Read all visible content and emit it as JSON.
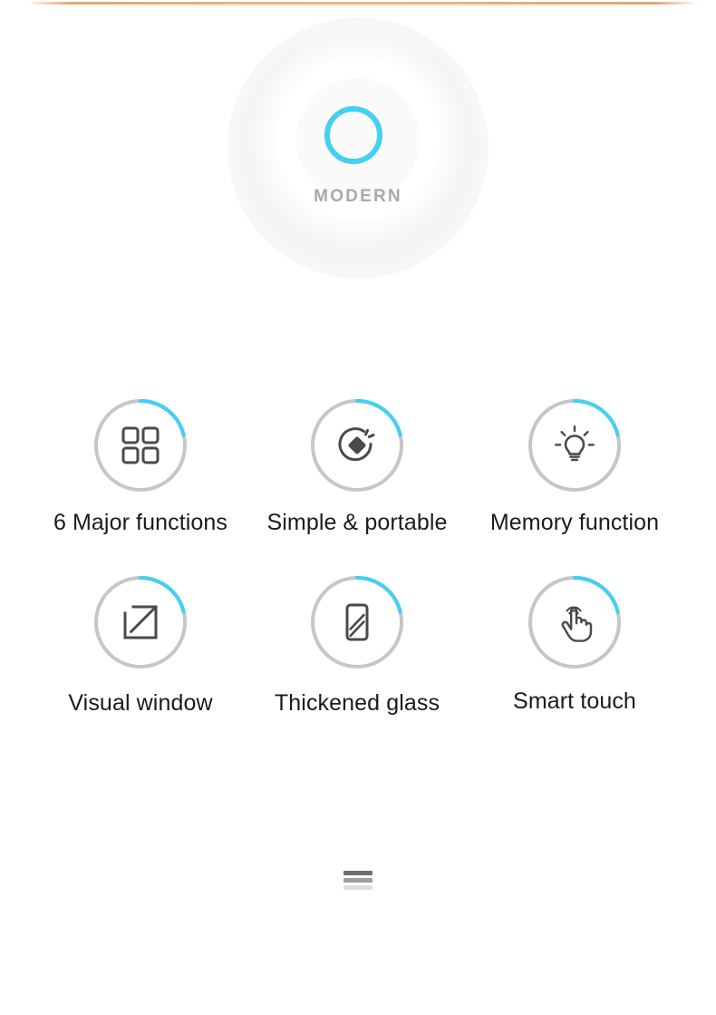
{
  "page": {
    "background_color": "#ffffff",
    "accent_color": "#45cff0",
    "ring_color": "#c6c6c6",
    "glyph_color": "#4a4a4a",
    "label_color": "#1b1b1b",
    "top_rule_color": "#e9b07c"
  },
  "hero": {
    "logo_icon": "cyan-ring-logo",
    "wordmark": "MODERN",
    "wordmark_color": "#a9a9a9",
    "backdrop_icon": "soft-gray-disc"
  },
  "features": {
    "rows": [
      {
        "cells": [
          {
            "icon": "grid-four-squares-icon",
            "label": "6 Major functions"
          },
          {
            "icon": "diamond-in-circle-sparkle-icon",
            "label": "Simple & portable"
          },
          {
            "icon": "lightbulb-icon",
            "label": "Memory function"
          }
        ]
      },
      {
        "cells": [
          {
            "icon": "expand-arrow-window-icon",
            "label": "Visual window"
          },
          {
            "icon": "glass-panel-shine-icon",
            "label": "Thickened glass"
          },
          {
            "icon": "touch-hand-tap-icon",
            "label": "Smart touch"
          }
        ]
      }
    ]
  },
  "footer": {
    "menu_icon": "hamburger-menu-icon",
    "menu_line_colors": [
      "#6f6f6f",
      "#9e9e9e",
      "#dedede"
    ]
  }
}
